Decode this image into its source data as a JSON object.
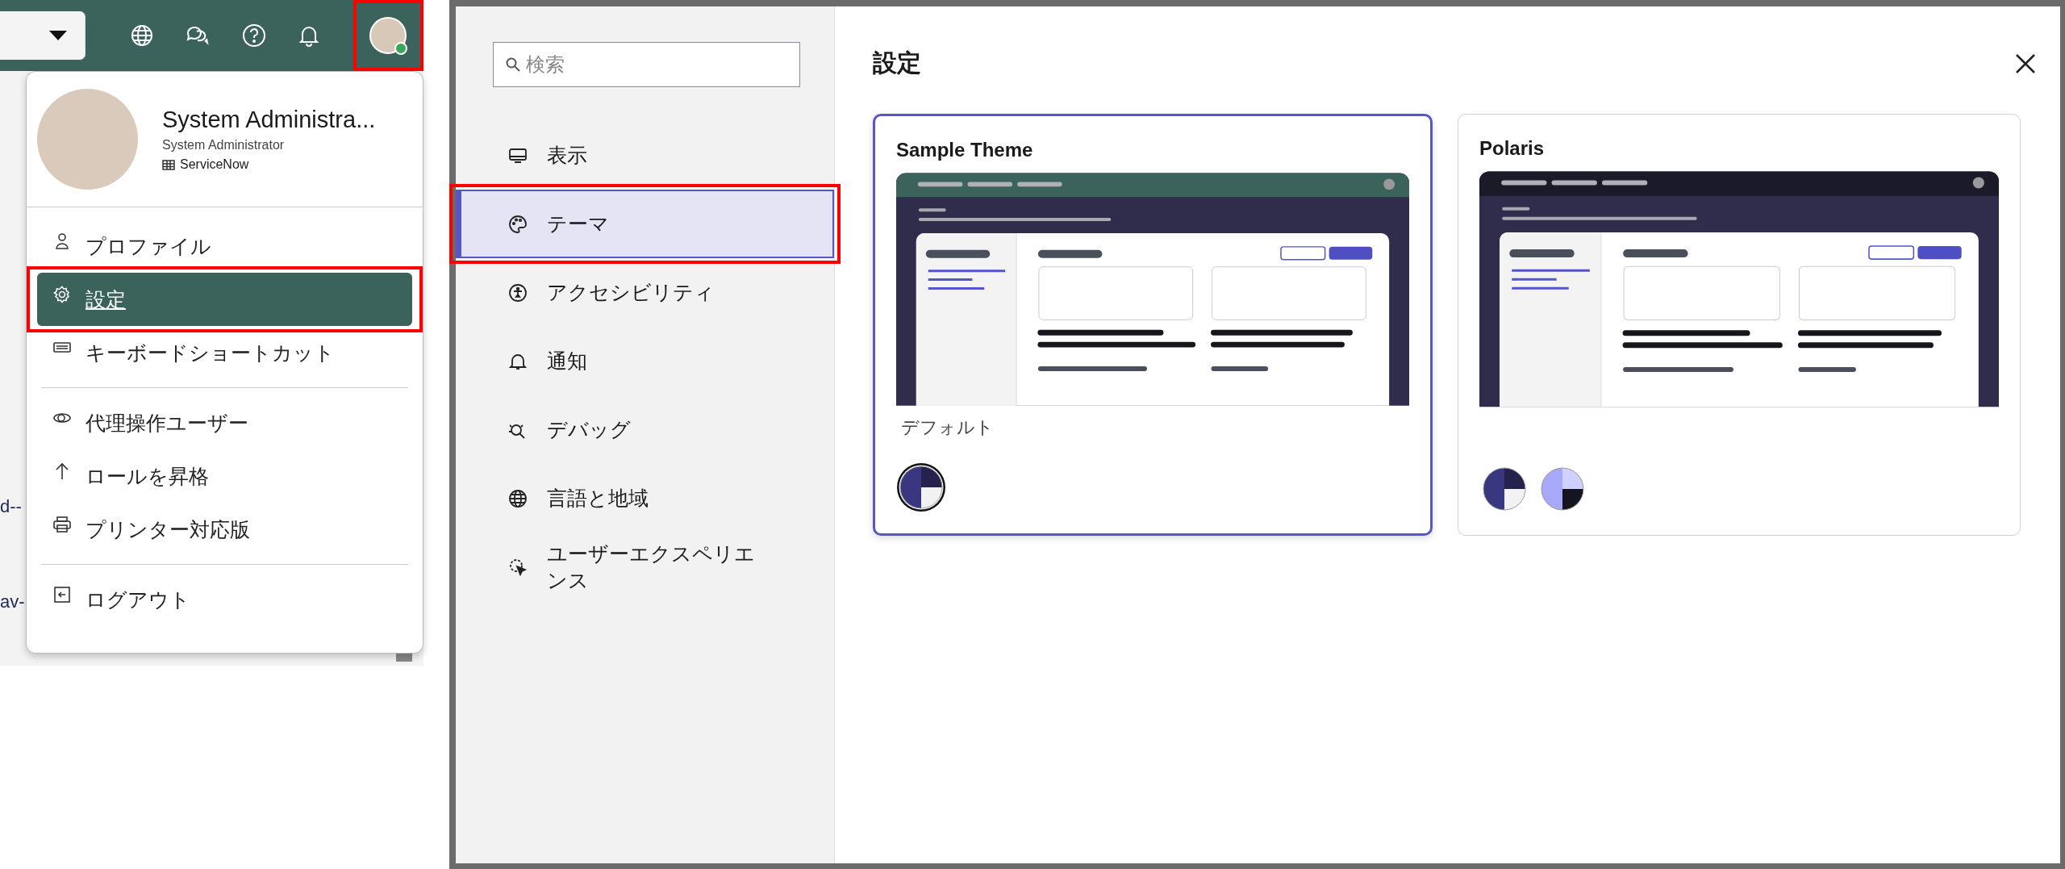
{
  "background_fragments": [
    "d--",
    "av-"
  ],
  "profile_menu": {
    "user": {
      "name": "System Administra...",
      "title": "System Administrator",
      "company": "ServiceNow"
    },
    "groups": [
      [
        {
          "label": "プロファイル",
          "selected": false
        },
        {
          "label": "設定",
          "selected": true
        },
        {
          "label": "キーボードショートカット",
          "selected": false
        }
      ],
      [
        {
          "label": "代理操作ユーザー",
          "selected": false
        },
        {
          "label": "ロールを昇格",
          "selected": false
        },
        {
          "label": "プリンター対応版",
          "selected": false
        }
      ],
      [
        {
          "label": "ログアウト",
          "selected": false
        }
      ]
    ]
  },
  "settings": {
    "search": {
      "placeholder": "検索"
    },
    "nav": [
      {
        "label": "表示",
        "selected": false
      },
      {
        "label": "テーマ",
        "selected": true
      },
      {
        "label": "アクセシビリティ",
        "selected": false
      },
      {
        "label": "通知",
        "selected": false
      },
      {
        "label": "デバッグ",
        "selected": false
      },
      {
        "label": "言語と地域",
        "selected": false
      },
      {
        "label": "ユーザーエクスペリエンス",
        "selected": false
      }
    ],
    "title": "設定",
    "themes": [
      {
        "name": "Sample Theme",
        "selected": true,
        "color": "#3b635c",
        "caption": "デフォルト",
        "swatches": [
          {
            "kind": "dark",
            "selected": true
          }
        ]
      },
      {
        "name": "Polaris",
        "selected": false,
        "color": "#1b1a28",
        "swatches": [
          {
            "kind": "dark",
            "selected": false
          },
          {
            "kind": "light",
            "selected": false
          }
        ]
      }
    ]
  }
}
